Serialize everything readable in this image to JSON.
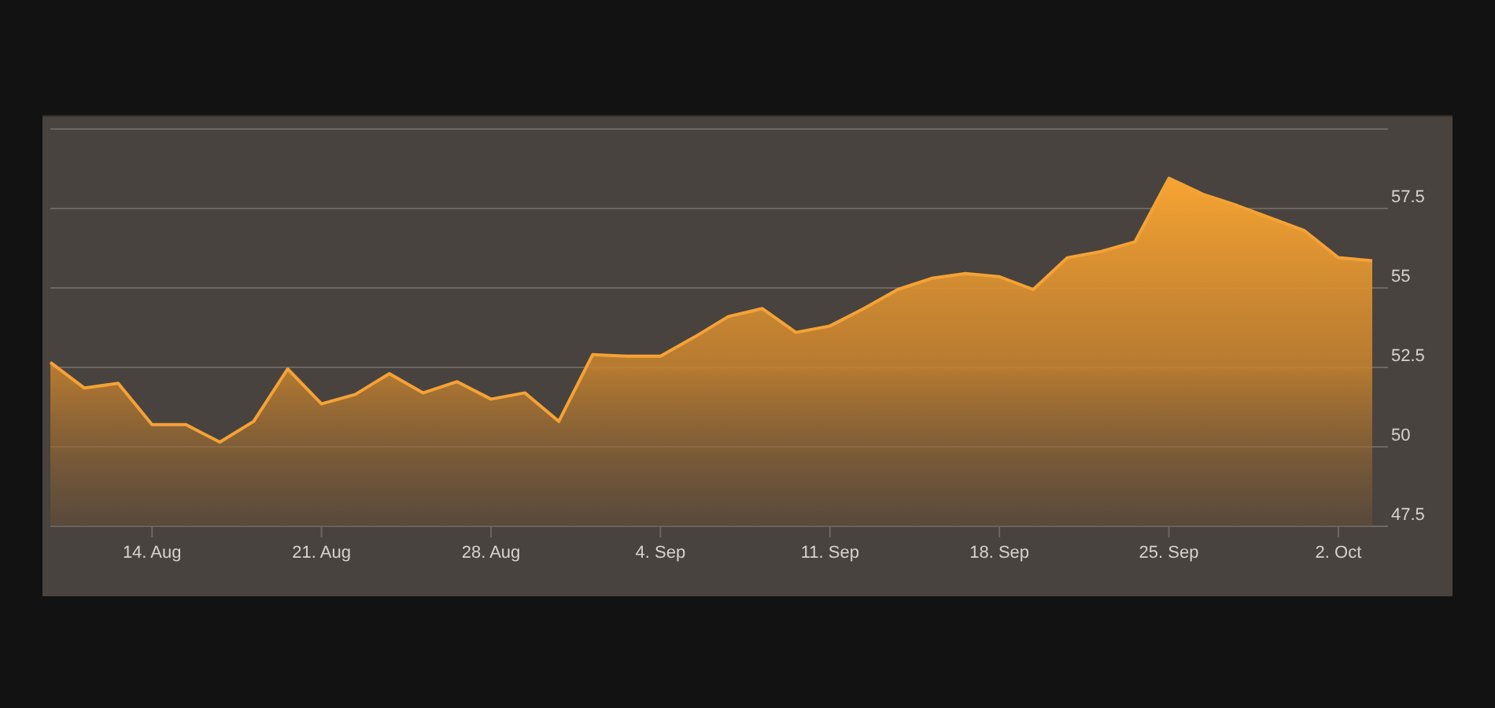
{
  "panel": {
    "chart_data": {
      "type": "area",
      "categories": [
        null,
        null,
        null,
        "14. Aug",
        null,
        null,
        null,
        null,
        "21. Aug",
        null,
        null,
        null,
        null,
        "28. Aug",
        null,
        null,
        null,
        null,
        "4. Sep",
        null,
        null,
        null,
        null,
        "11. Sep",
        null,
        null,
        null,
        null,
        "18. Sep",
        null,
        null,
        null,
        null,
        "25. Sep",
        null,
        null,
        null,
        null,
        "2. Oct",
        null
      ],
      "ylim": [
        47.5,
        60
      ],
      "grid": true,
      "yticks": [
        47.5,
        50,
        52.5,
        55,
        57.5
      ],
      "series": [
        {
          "color": "#f5a235",
          "values": [
            52.66,
            51.85,
            52.0,
            50.7,
            50.7,
            50.15,
            50.8,
            52.45,
            51.35,
            51.65,
            52.3,
            51.7,
            52.05,
            51.5,
            51.7,
            50.8,
            52.9,
            52.85,
            52.85,
            53.45,
            54.1,
            54.35,
            53.6,
            53.8,
            54.35,
            54.95,
            55.3,
            55.45,
            55.35,
            54.95,
            55.95,
            56.15,
            56.45,
            58.45,
            57.95,
            57.6,
            57.2,
            56.8,
            55.95,
            55.85
          ]
        }
      ]
    }
  }
}
